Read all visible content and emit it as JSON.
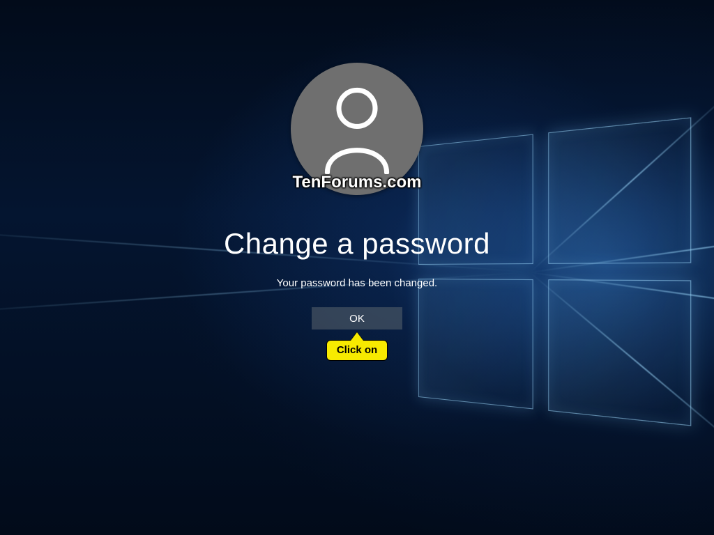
{
  "watermark": "TenForums.com",
  "heading": "Change a password",
  "message": "Your password has been changed.",
  "ok_label": "OK",
  "callout_label": "Click on",
  "icons": {
    "avatar": "user-icon",
    "logo": "windows-logo"
  },
  "colors": {
    "callout_bg": "#f7ea00",
    "avatar_bg": "#6f6f6f"
  }
}
